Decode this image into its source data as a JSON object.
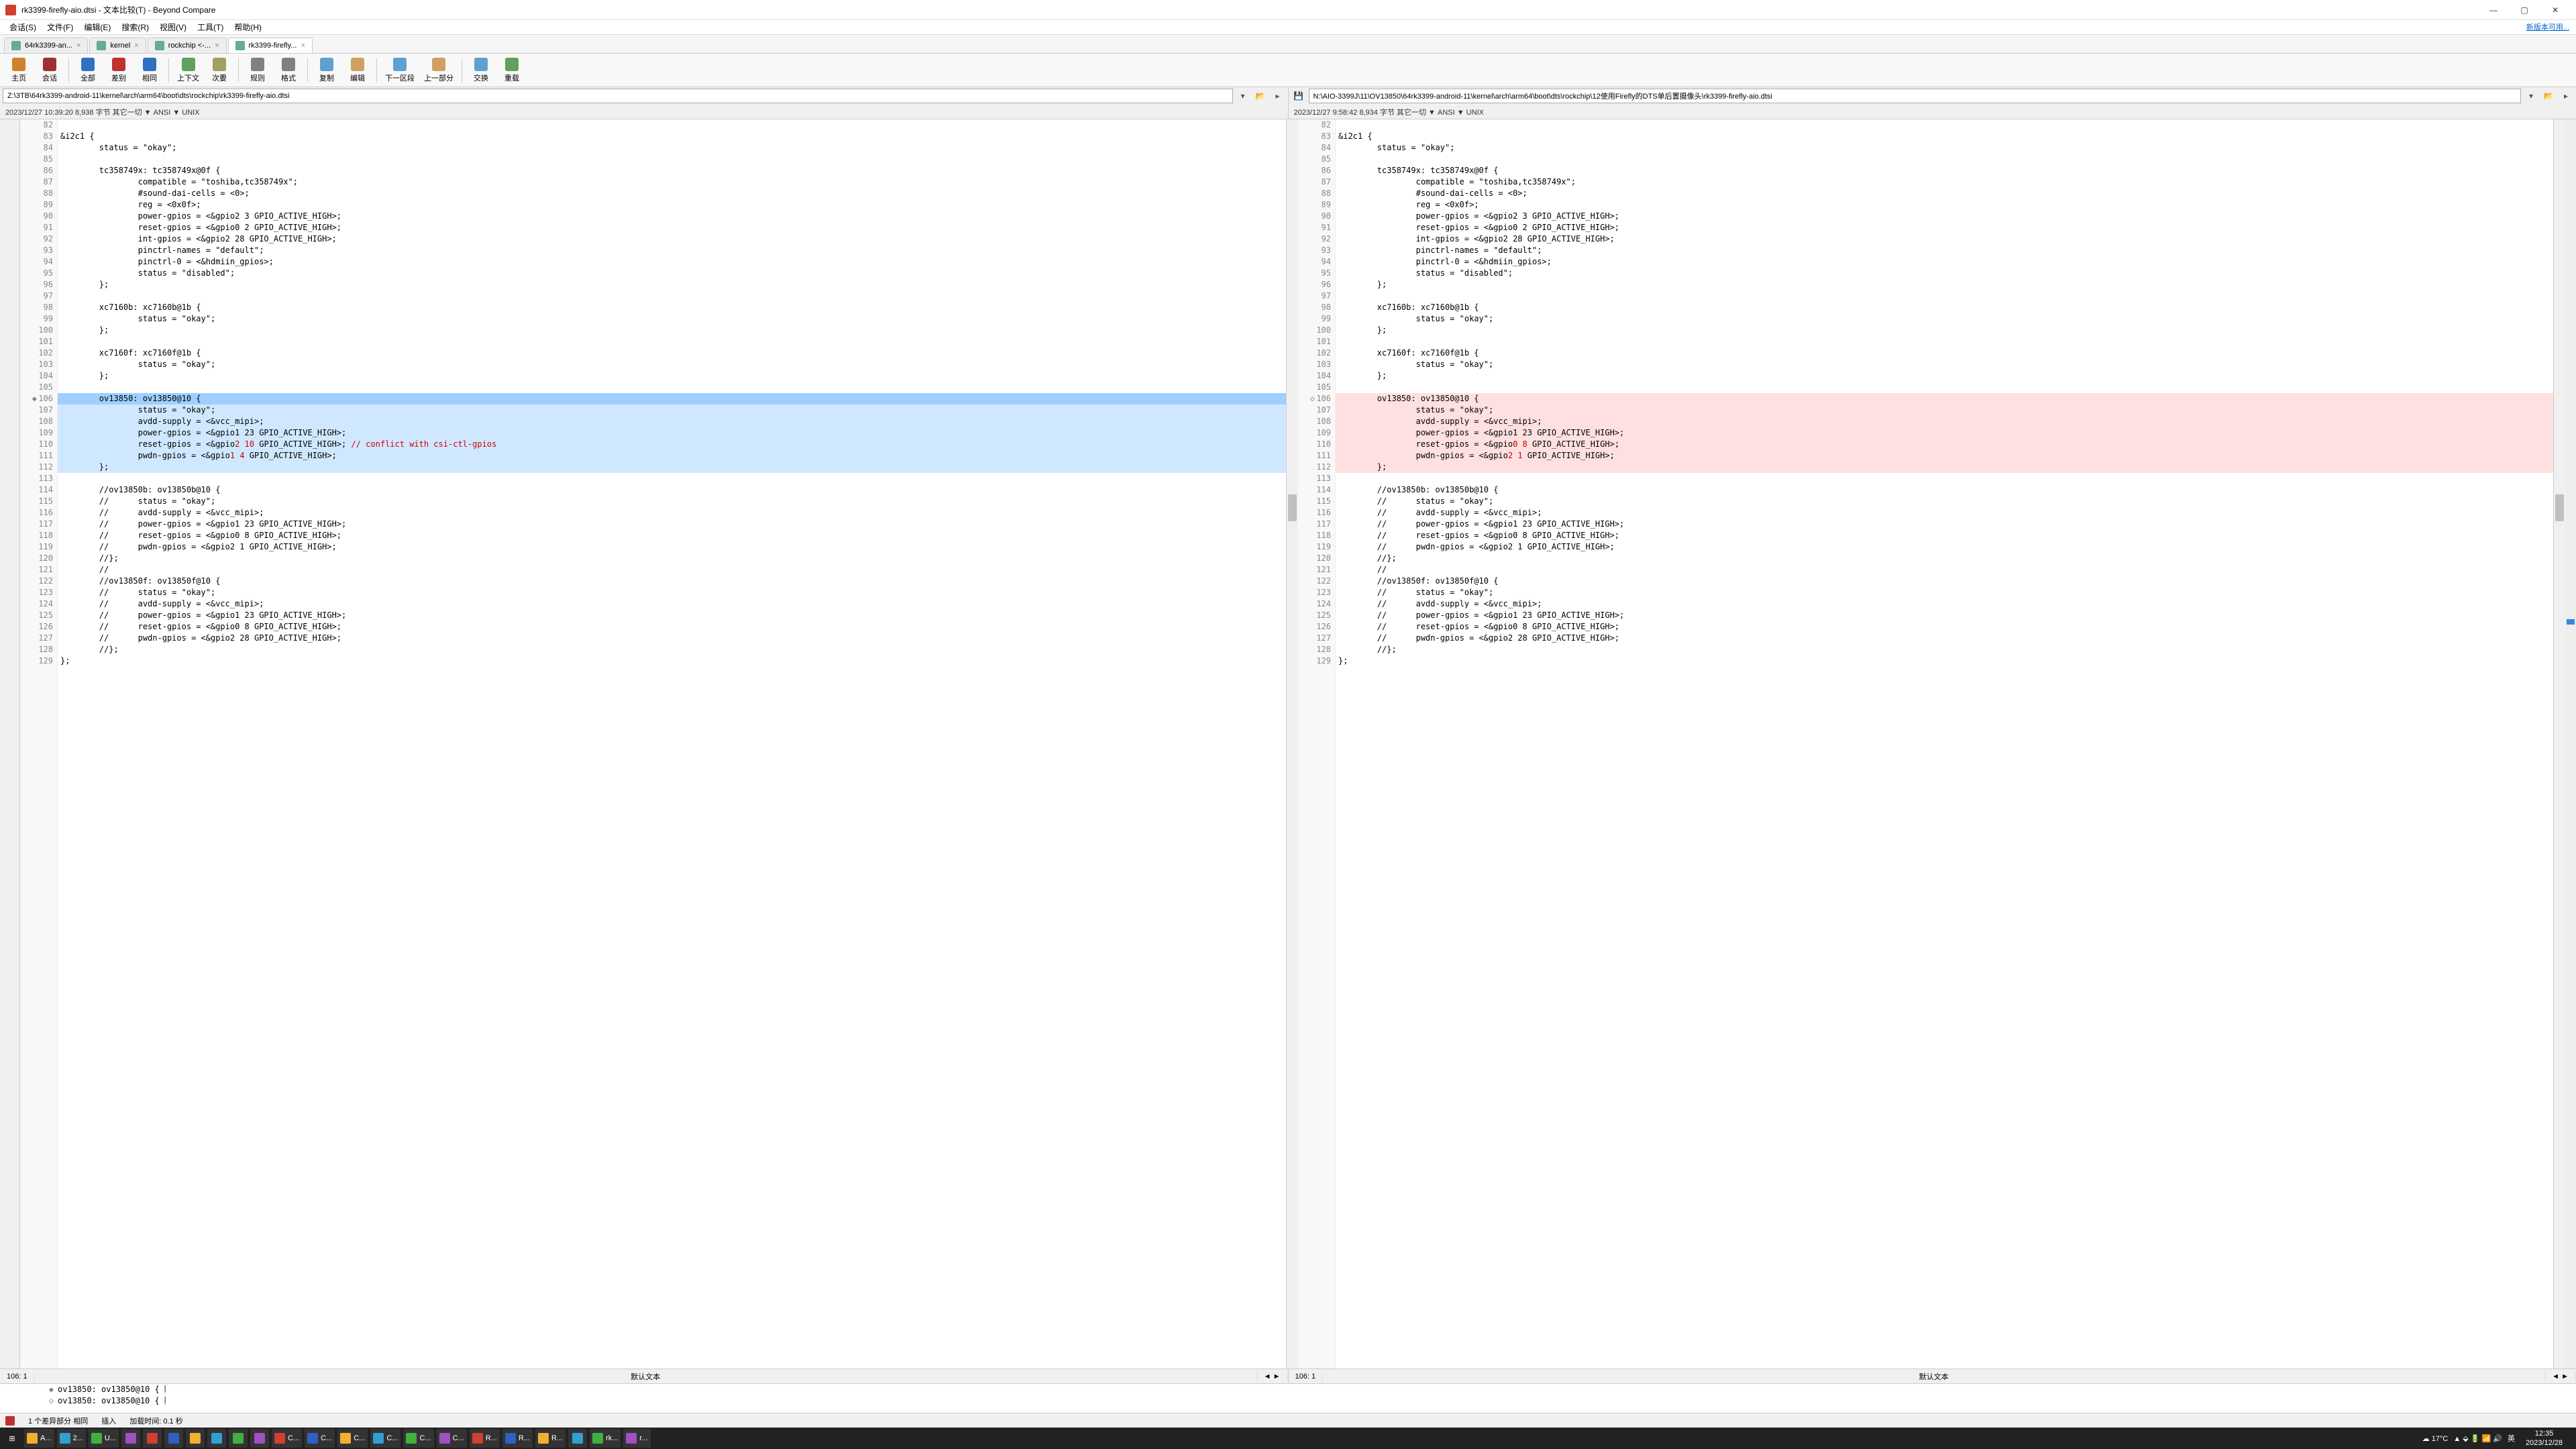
{
  "window": {
    "title": "rk3399-firefly-aio.dtsi - 文本比较(T) - Beyond Compare",
    "newversion": "新版本可用..."
  },
  "menu": [
    "会话(S)",
    "文件(F)",
    "编辑(E)",
    "搜索(R)",
    "视图(V)",
    "工具(T)",
    "帮助(H)"
  ],
  "tabs": [
    {
      "label": "64rk3399-an...",
      "active": false
    },
    {
      "label": "kernel",
      "active": false
    },
    {
      "label": "rockchip  <-...",
      "active": false
    },
    {
      "label": "rk3399-firefly...",
      "active": true
    }
  ],
  "toolbar": [
    {
      "label": "主页",
      "color": "#d08030"
    },
    {
      "label": "会话",
      "color": "#a03030"
    },
    {
      "sep": true
    },
    {
      "label": "全部",
      "color": "#3070c0"
    },
    {
      "label": "差别",
      "color": "#c03030"
    },
    {
      "label": "相同",
      "color": "#3070c0"
    },
    {
      "sep": true
    },
    {
      "label": "上下文",
      "color": "#60a060"
    },
    {
      "label": "次要",
      "color": "#a0a060"
    },
    {
      "sep": true
    },
    {
      "label": "规则",
      "color": "#808080"
    },
    {
      "label": "格式",
      "color": "#808080"
    },
    {
      "sep": true
    },
    {
      "label": "复制",
      "color": "#60a0d0"
    },
    {
      "label": "编辑",
      "color": "#d0a060"
    },
    {
      "sep": true
    },
    {
      "label": "下一区段",
      "color": "#60a0d0"
    },
    {
      "label": "上一部分",
      "color": "#d0a060"
    },
    {
      "sep": true
    },
    {
      "label": "交换",
      "color": "#60a0d0"
    },
    {
      "label": "重载",
      "color": "#60a060"
    }
  ],
  "left": {
    "path": "Z:\\3TB\\64rk3399-android-11\\kernel\\arch\\arm64\\boot\\dts\\rockchip\\rk3399-firefly-aio.dtsi",
    "info": "2023/12/27 10:39:20   8,938 字节   其它一切 ▼ ANSI ▼ UNIX",
    "status_pos": "106: 1",
    "status_mode": "默认文本"
  },
  "right": {
    "path": "N:\\AIO-3399J\\11\\OV13850\\64rk3399-android-11\\kernel\\arch\\arm64\\boot\\dts\\rockchip\\12使用Firefly的DTS单后置摄像头\\rk3399-firefly-aio.dtsi",
    "info": "2023/12/27 9:58:42   8,934 字节   其它一切 ▼ ANSI ▼ UNIX",
    "status_pos": "106: 1",
    "status_mode": "默认文本"
  },
  "code_lines": {
    "start": 82,
    "left": [
      "",
      "&i2c1 {",
      "        status = \"okay\";",
      "",
      "        tc358749x: tc358749x@0f {",
      "                compatible = \"toshiba,tc358749x\";",
      "                #sound-dai-cells = <0>;",
      "                reg = <0x0f>;",
      "                power-gpios = <&gpio2 3 GPIO_ACTIVE_HIGH>;",
      "                reset-gpios = <&gpio0 2 GPIO_ACTIVE_HIGH>;",
      "                int-gpios = <&gpio2 28 GPIO_ACTIVE_HIGH>;",
      "                pinctrl-names = \"default\";",
      "                pinctrl-0 = <&hdmiin_gpios>;",
      "                status = \"disabled\";",
      "        };",
      "",
      "        xc7160b: xc7160b@1b {",
      "                status = \"okay\";",
      "        };",
      "",
      "        xc7160f: xc7160f@1b {",
      "                status = \"okay\";",
      "        };",
      "",
      "        ov13850: ov13850@10 {",
      "                status = \"okay\";",
      "                avdd-supply = <&vcc_mipi>;",
      "                power-gpios = <&gpio1 23 GPIO_ACTIVE_HIGH>;",
      "                reset-gpios = <&gpio2 10 GPIO_ACTIVE_HIGH>; // conflict with csi-ctl-gpios",
      "                pwdn-gpios = <&gpio1 4 GPIO_ACTIVE_HIGH>;",
      "        };",
      "",
      "        //ov13850b: ov13850b@10 {",
      "        //      status = \"okay\";",
      "        //      avdd-supply = <&vcc_mipi>;",
      "        //      power-gpios = <&gpio1 23 GPIO_ACTIVE_HIGH>;",
      "        //      reset-gpios = <&gpio0 8 GPIO_ACTIVE_HIGH>;",
      "        //      pwdn-gpios = <&gpio2 1 GPIO_ACTIVE_HIGH>;",
      "        //};",
      "        //",
      "        //ov13850f: ov13850f@10 {",
      "        //      status = \"okay\";",
      "        //      avdd-supply = <&vcc_mipi>;",
      "        //      power-gpios = <&gpio1 23 GPIO_ACTIVE_HIGH>;",
      "        //      reset-gpios = <&gpio0 8 GPIO_ACTIVE_HIGH>;",
      "        //      pwdn-gpios = <&gpio2 28 GPIO_ACTIVE_HIGH>;",
      "        //};",
      "};"
    ],
    "right": [
      "",
      "&i2c1 {",
      "        status = \"okay\";",
      "",
      "        tc358749x: tc358749x@0f {",
      "                compatible = \"toshiba,tc358749x\";",
      "                #sound-dai-cells = <0>;",
      "                reg = <0x0f>;",
      "                power-gpios = <&gpio2 3 GPIO_ACTIVE_HIGH>;",
      "                reset-gpios = <&gpio0 2 GPIO_ACTIVE_HIGH>;",
      "                int-gpios = <&gpio2 28 GPIO_ACTIVE_HIGH>;",
      "                pinctrl-names = \"default\";",
      "                pinctrl-0 = <&hdmiin_gpios>;",
      "                status = \"disabled\";",
      "        };",
      "",
      "        xc7160b: xc7160b@1b {",
      "                status = \"okay\";",
      "        };",
      "",
      "        xc7160f: xc7160f@1b {",
      "                status = \"okay\";",
      "        };",
      "",
      "        ov13850: ov13850@10 {",
      "                status = \"okay\";",
      "                avdd-supply = <&vcc_mipi>;",
      "                power-gpios = <&gpio1 23 GPIO_ACTIVE_HIGH>;",
      "                reset-gpios = <&gpio0 8 GPIO_ACTIVE_HIGH>;",
      "                pwdn-gpios = <&gpio2 1 GPIO_ACTIVE_HIGH>;",
      "        };",
      "",
      "        //ov13850b: ov13850b@10 {",
      "        //      status = \"okay\";",
      "        //      avdd-supply = <&vcc_mipi>;",
      "        //      power-gpios = <&gpio1 23 GPIO_ACTIVE_HIGH>;",
      "        //      reset-gpios = <&gpio0 8 GPIO_ACTIVE_HIGH>;",
      "        //      pwdn-gpios = <&gpio2 1 GPIO_ACTIVE_HIGH>;",
      "        //};",
      "        //",
      "        //ov13850f: ov13850f@10 {",
      "        //      status = \"okay\";",
      "        //      avdd-supply = <&vcc_mipi>;",
      "        //      power-gpios = <&gpio1 23 GPIO_ACTIVE_HIGH>;",
      "        //      reset-gpios = <&gpio0 8 GPIO_ACTIVE_HIGH>;",
      "        //      pwdn-gpios = <&gpio2 28 GPIO_ACTIVE_HIGH>;",
      "        //};",
      "};"
    ],
    "diff_start": 106,
    "diff_end": 112,
    "diff_key_left": [
      110,
      111
    ],
    "diff_key_right": [
      110,
      111
    ]
  },
  "bottom": [
    {
      "mark": "◆",
      "text": "        ov13850: ov13850@10 {"
    },
    {
      "mark": "◇",
      "text": "        ov13850: ov13850@10 {"
    }
  ],
  "statusbar": {
    "diffcount": "1 个差异部分   相同",
    "insert": "插入",
    "loadtime": "加载时间: 0.1 秒"
  },
  "taskbar": {
    "weather": "17°C",
    "ime": "英",
    "time": "12:35",
    "date": "2023/12/28",
    "apps": [
      "A...",
      "2...",
      "U...",
      "",
      "",
      "",
      "",
      "",
      "",
      "",
      "C...",
      "C...",
      "C...",
      "C...",
      "C...",
      "C...",
      "R...",
      "R...",
      "R...",
      "",
      "rk...",
      "r..."
    ]
  }
}
